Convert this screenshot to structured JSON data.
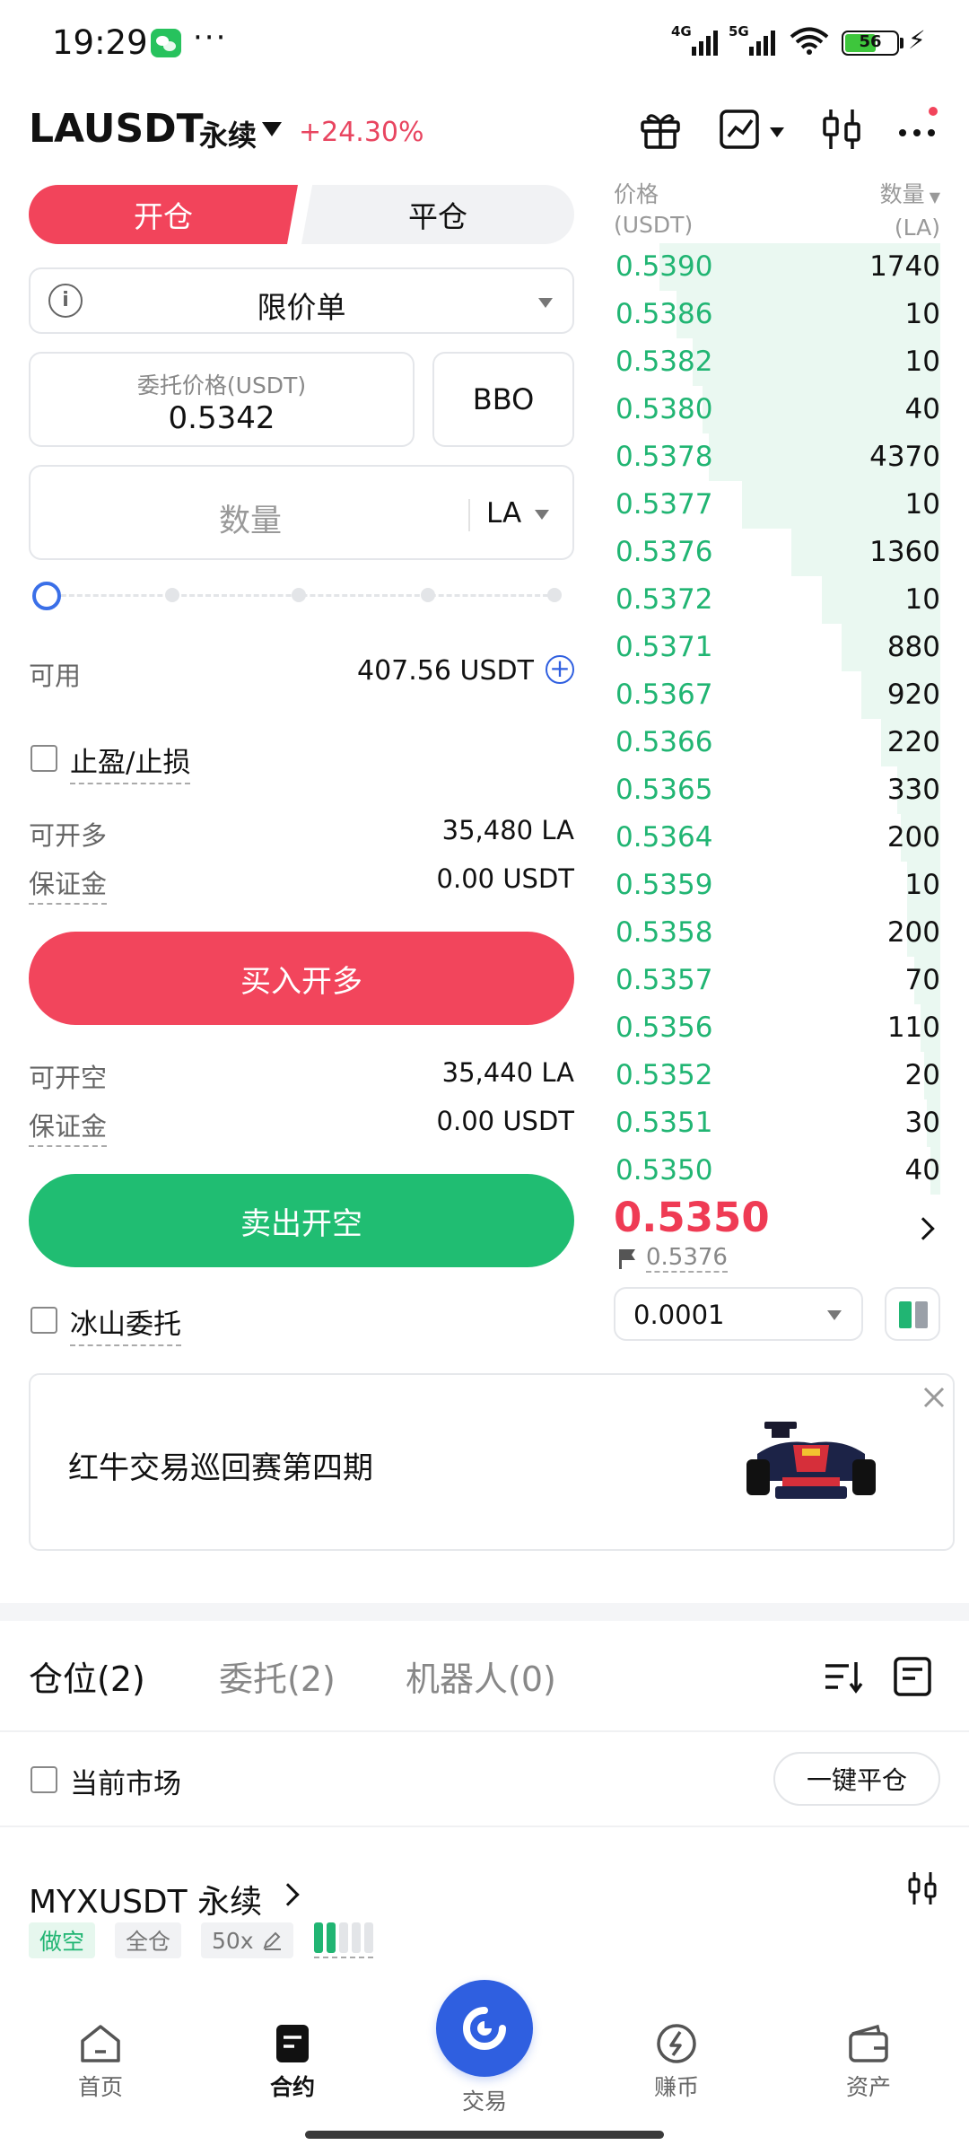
{
  "status_bar": {
    "time": "19:29",
    "dots": "···",
    "signal_1": "4G",
    "signal_2": "5G",
    "battery": "56"
  },
  "header": {
    "pair": "LAUSDT",
    "contract_type": "永续",
    "change": "+24.30%",
    "icons": [
      "gift-icon",
      "chart-icon",
      "candlestick-icon",
      "more-icon"
    ]
  },
  "form": {
    "open_tab": "开仓",
    "close_tab": "平仓",
    "order_type": "限价单",
    "price_label": "委托价格(USDT)",
    "price_value": "0.5342",
    "bbo": "BBO",
    "qty_placeholder": "数量",
    "qty_unit": "LA",
    "slider_percent": 0,
    "available_label": "可用",
    "available_value": "407.56 USDT",
    "tpsl_label": "止盈/止损",
    "long_max_label": "可开多",
    "long_max_value": "35,480 LA",
    "long_margin_label": "保证金",
    "long_margin_value": "0.00 USDT",
    "long_button": "买入开多",
    "short_max_label": "可开空",
    "short_max_value": "35,440 LA",
    "short_margin_label": "保证金",
    "short_margin_value": "0.00 USDT",
    "short_button": "卖出开空",
    "iceberg_label": "冰山委托"
  },
  "orderbook": {
    "price_header": "价格",
    "price_unit": "(USDT)",
    "qty_header": "数量",
    "qty_unit": "(LA)",
    "rows": [
      {
        "price": "0.5390",
        "qty": "1740",
        "depth": 0.85
      },
      {
        "price": "0.5386",
        "qty": "10",
        "depth": 0.8
      },
      {
        "price": "0.5382",
        "qty": "10",
        "depth": 0.75
      },
      {
        "price": "0.5380",
        "qty": "40",
        "depth": 0.72
      },
      {
        "price": "0.5378",
        "qty": "4370",
        "depth": 0.7
      },
      {
        "price": "0.5377",
        "qty": "10",
        "depth": 0.6
      },
      {
        "price": "0.5376",
        "qty": "1360",
        "depth": 0.45
      },
      {
        "price": "0.5372",
        "qty": "10",
        "depth": 0.36
      },
      {
        "price": "0.5371",
        "qty": "880",
        "depth": 0.3
      },
      {
        "price": "0.5367",
        "qty": "920",
        "depth": 0.24
      },
      {
        "price": "0.5366",
        "qty": "220",
        "depth": 0.18
      },
      {
        "price": "0.5365",
        "qty": "330",
        "depth": 0.13
      },
      {
        "price": "0.5364",
        "qty": "200",
        "depth": 0.12
      },
      {
        "price": "0.5359",
        "qty": "10",
        "depth": 0.1
      },
      {
        "price": "0.5358",
        "qty": "200",
        "depth": 0.1
      },
      {
        "price": "0.5357",
        "qty": "70",
        "depth": 0.08
      },
      {
        "price": "0.5356",
        "qty": "110",
        "depth": 0.06
      },
      {
        "price": "0.5352",
        "qty": "20",
        "depth": 0.05
      },
      {
        "price": "0.5351",
        "qty": "30",
        "depth": 0.04
      },
      {
        "price": "0.5350",
        "qty": "40",
        "depth": 0.03
      }
    ],
    "last_price": "0.5350",
    "mark_price": "0.5376",
    "precision": "0.0001"
  },
  "banner": {
    "text": "红牛交易巡回赛第四期"
  },
  "positions": {
    "tab_positions": "仓位(2)",
    "tab_orders": "委托(2)",
    "tab_bots": "机器人(0)",
    "current_market": "当前市场",
    "close_all": "一键平仓",
    "item": {
      "symbol": "MYXUSDT 永续",
      "side": "做空",
      "margin_mode": "全仓",
      "leverage": "50x",
      "risk_level": 2
    }
  },
  "nav": {
    "home": "首页",
    "futures": "合约",
    "trade": "交易",
    "earn": "赚币",
    "assets": "资产"
  },
  "colors": {
    "red": "#f2445b",
    "green": "#20bd72",
    "blue": "#2f5fe0"
  }
}
